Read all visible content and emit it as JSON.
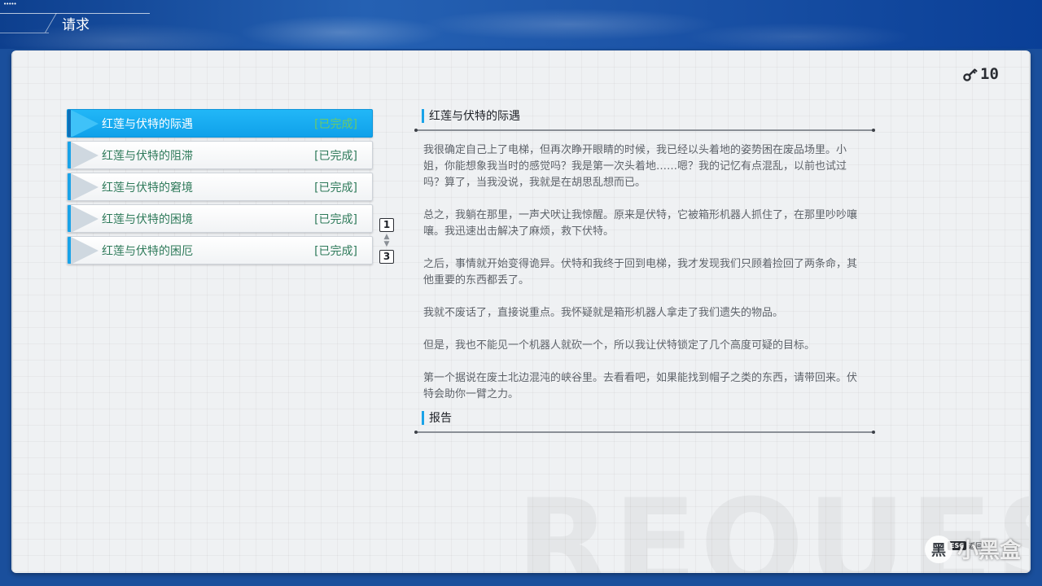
{
  "header": {
    "title": "请求",
    "signal": "•••••"
  },
  "key_counter": {
    "icon": "key-icon",
    "count": "10"
  },
  "watermark": "REQUEST",
  "quests": [
    {
      "name": "红莲与伏特的际遇",
      "status": "[已完成]",
      "active": true
    },
    {
      "name": "红莲与伏特的阻滞",
      "status": "[已完成]",
      "active": false
    },
    {
      "name": "红莲与伏特的窘境",
      "status": "[已完成]",
      "active": false
    },
    {
      "name": "红莲与伏特的困境",
      "status": "[已完成]",
      "active": false
    },
    {
      "name": "红莲与伏特的困厄",
      "status": "[已完成]",
      "active": false
    }
  ],
  "pager": {
    "current": "1",
    "total": "3"
  },
  "detail": {
    "title": "红莲与伏特的际遇",
    "paragraphs": [
      "我很确定自己上了电梯，但再次睁开眼睛的时候，我已经以头着地的姿势困在废品场里。小姐，你能想象我当时的感觉吗？我是第一次头着地……嗯？我的记忆有点混乱，以前也试过吗？算了，当我没说，我就是在胡思乱想而已。",
      "总之，我躺在那里，一声犬吠让我惊醒。原来是伏特，它被箱形机器人抓住了，在那里吵吵嚷嚷。我迅速出击解决了麻烦，救下伏特。",
      "之后，事情就开始变得诡异。伏特和我终于回到电梯，我才发现我们只顾着捡回了两条命，其他重要的东西都丢了。",
      "我就不废话了，直接说重点。我怀疑就是箱形机器人拿走了我们遗失的物品。",
      "但是，我也不能见一个机器人就砍一个，所以我让伏特锁定了几个高度可疑的目标。",
      "第一个据说在废土北边混沌的峡谷里。去看看吧，如果能找到帽子之类的东西，请带回来。伏特会助你一臂之力。"
    ],
    "report_title": "报告"
  },
  "esc_hint": {
    "key": "ESC",
    "label": "返回"
  },
  "brand": {
    "logo": "黑",
    "text": "小黑盒"
  },
  "colors": {
    "accent": "#1aa3e8",
    "active_item": "#22b7f7",
    "completed_text": "#2e7a5a",
    "header_blue": "#1d55a8"
  }
}
